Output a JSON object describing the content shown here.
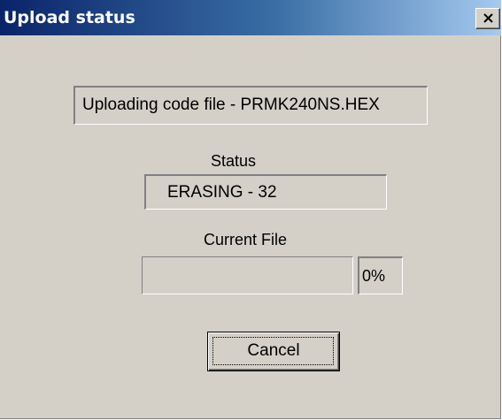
{
  "window": {
    "title": "Upload status",
    "close_icon": "close-icon"
  },
  "upload": {
    "file_text": "Uploading code file -  PRMK240NS.HEX"
  },
  "status": {
    "label": "Status",
    "value": "ERASING - 32"
  },
  "current_file": {
    "label": "Current File",
    "progress_percent": 0,
    "percent_text": "0%"
  },
  "buttons": {
    "cancel_label": "Cancel"
  },
  "colors": {
    "title_gradient_start": "#0a246a",
    "title_gradient_end": "#a6caf0",
    "dialog_background": "#d4d0c8"
  }
}
